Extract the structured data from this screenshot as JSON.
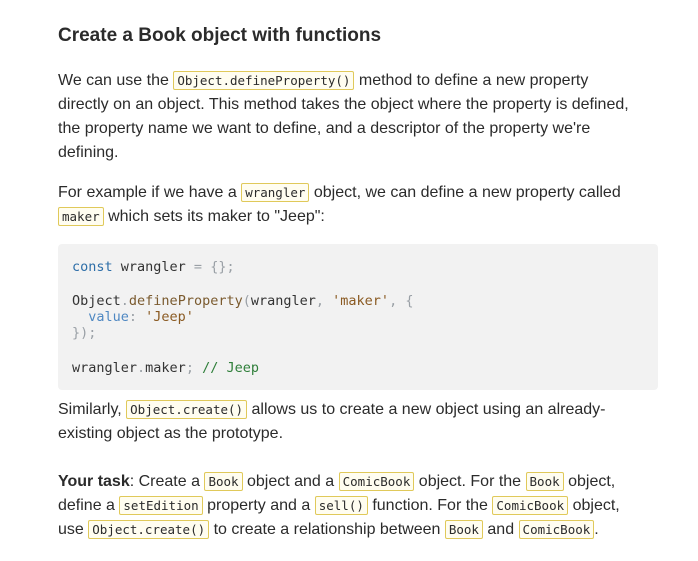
{
  "heading": "Create a Book object with functions",
  "para1": {
    "t1": "We can use the ",
    "c1": "Object.defineProperty()",
    "t2": " method to define a new property",
    "l2": "directly on an object. This method takes the object where the property is defined,",
    "l3": "the property name we want to define, and a descriptor of the property we're",
    "l4": "defining."
  },
  "para2": {
    "t1": "For example if we have a ",
    "c1": "wrangler",
    "t2": " object, we can define a new property called",
    "c2": "maker",
    "t3": " which sets its maker to \"Jeep\":"
  },
  "code": {
    "l1_kw": "const",
    "l1_var": " wrangler ",
    "l1_eq": "=",
    "l1_obj": " {};",
    "l3_obj": "Object",
    "l3_dot": ".",
    "l3_fn": "defineProperty",
    "l3_open": "(",
    "l3_arg": "wrangler",
    "l3_c1": ", ",
    "l3_str": "'maker'",
    "l3_c2": ", {",
    "l4_prop": "  value",
    "l4_colon": ": ",
    "l4_str": "'Jeep'",
    "l5": "});",
    "l7_var": "wrangler",
    "l7_dot": ".",
    "l7_prop": "maker",
    "l7_semi": "; ",
    "l7_cm": "// Jeep"
  },
  "para3": {
    "t1": "Similarly, ",
    "c1": "Object.create()",
    "t2": " allows us to create a new object using an already-",
    "l2": "existing object as the prototype."
  },
  "task": {
    "label": "Your task",
    "t1": ": Create a ",
    "c1": "Book",
    "t2": " object and a ",
    "c2": "ComicBook",
    "t3": " object. For the ",
    "c3": "Book",
    "t4": " object,",
    "t5": "define a ",
    "c4": "setEdition",
    "t6": " property and a ",
    "c5": "sell()",
    "t7": " function. For the ",
    "c6": "ComicBook",
    "t8": " object,",
    "t9": "use ",
    "c7": "Object.create()",
    "t10": " to create a relationship between ",
    "c8": "Book",
    "t11": " and ",
    "c9": "ComicBook",
    "t12": "."
  }
}
